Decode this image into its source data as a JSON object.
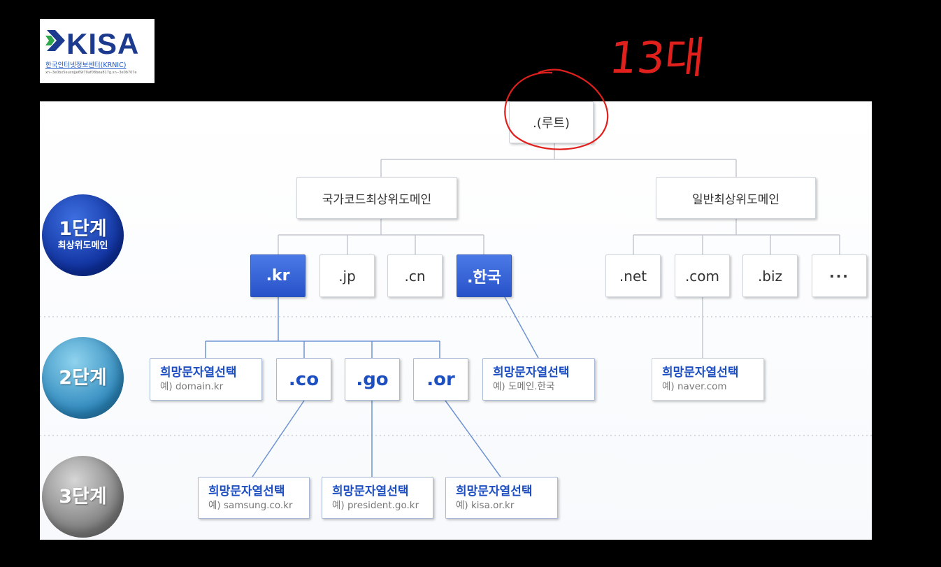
{
  "logo": {
    "name": "KISA",
    "subtitle": "한국인터넷정보센터(KRNIC)",
    "url": "xn--3e0bx5euxnjje69i70af08bea817g.xn--3e0b707e"
  },
  "annotation": "13대",
  "root": ".(루트)",
  "first_level": {
    "cc_tld": "국가코드최상위도메인",
    "g_tld": "일반최상위도메인"
  },
  "tlds": [
    ".kr",
    ".jp",
    ".cn",
    ".한국",
    ".net",
    ".com",
    ".biz",
    "···"
  ],
  "second_level": {
    "kr_example_title": "희망문자열선택",
    "kr_example": "예) domain.kr",
    "co": ".co",
    "go": ".go",
    "or": ".or",
    "hangul_example_title": "희망문자열선택",
    "hangul_example": "예) 도메인.한국",
    "com_example_title": "희망문자열선택",
    "com_example": "예) naver.com"
  },
  "third_level": [
    {
      "title": "희망문자열선택",
      "example": "예) samsung.co.kr"
    },
    {
      "title": "희망문자열선택",
      "example": "예) president.go.kr"
    },
    {
      "title": "희망문자열선택",
      "example": "예) kisa.or.kr"
    }
  ],
  "levels": [
    {
      "label": "1단계",
      "sub": "최상위도메인"
    },
    {
      "label": "2단계"
    },
    {
      "label": "3단계"
    }
  ],
  "colors": {
    "selected_tld": "#2f5fd6",
    "level1": "#1540b5",
    "level2": "#3fa0cf",
    "level3": "#8d8d8d",
    "annotation": "#e0201c"
  }
}
